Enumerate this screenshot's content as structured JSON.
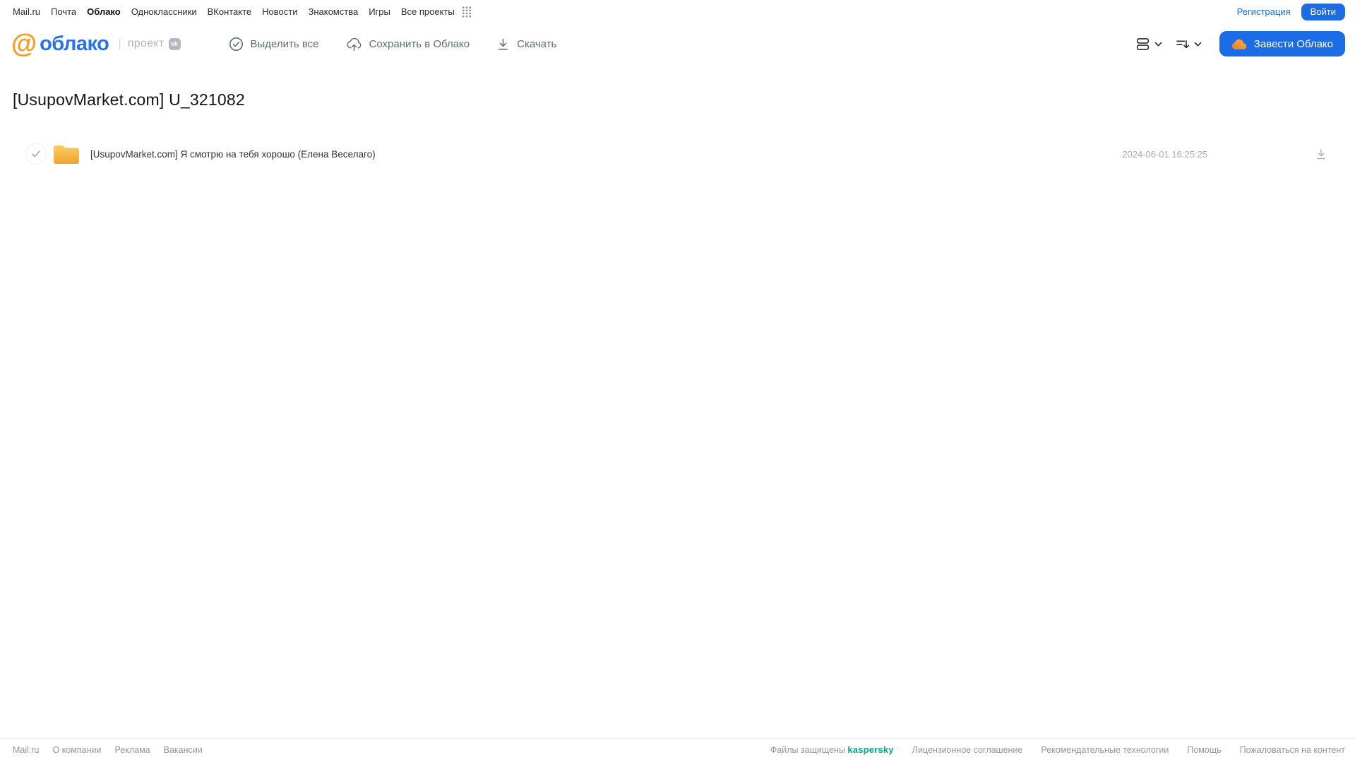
{
  "colors": {
    "accent_blue": "#1b6ce5",
    "logo_blue": "#2b71e7",
    "logo_orange": "#f99b1c",
    "kaspersky_green": "#00a88e",
    "folder_gradient_top": "#f9cc63",
    "folder_gradient_bottom": "#efa52f"
  },
  "topnav": {
    "items": [
      {
        "label": "Mail.ru"
      },
      {
        "label": "Почта"
      },
      {
        "label": "Облако"
      },
      {
        "label": "Одноклассники"
      },
      {
        "label": "ВКонтакте"
      },
      {
        "label": "Новости"
      },
      {
        "label": "Знакомства"
      },
      {
        "label": "Игры"
      },
      {
        "label": "Все проекты"
      }
    ],
    "registration_label": "Регистрация",
    "login_label": "Войти"
  },
  "header": {
    "logo_at": "@",
    "logo_text": "облако",
    "project_label": "проект",
    "vk_badge_label": "vk",
    "select_all_label": "Выделить все",
    "save_to_cloud_label": "Сохранить в Облако",
    "download_label": "Скачать",
    "create_cloud_label": "Завести Облако"
  },
  "content": {
    "title": "[UsupovMarket.com] U_321082",
    "file": {
      "name": "[UsupovMarket.com] Я смотрю на тебя хорошо (Елена Веселаго)",
      "date": "2024-06-01 16:25:25"
    }
  },
  "footer": {
    "links_left": [
      "Mail.ru",
      "О компании",
      "Реклама",
      "Вакансии"
    ],
    "protected_prefix": "Файлы защищены",
    "kaspersky_label": "kaspersky",
    "links_right": [
      "Лицензионное соглашение",
      "Рекомендательные технологии",
      "Помощь",
      "Пожаловаться на контент"
    ]
  }
}
